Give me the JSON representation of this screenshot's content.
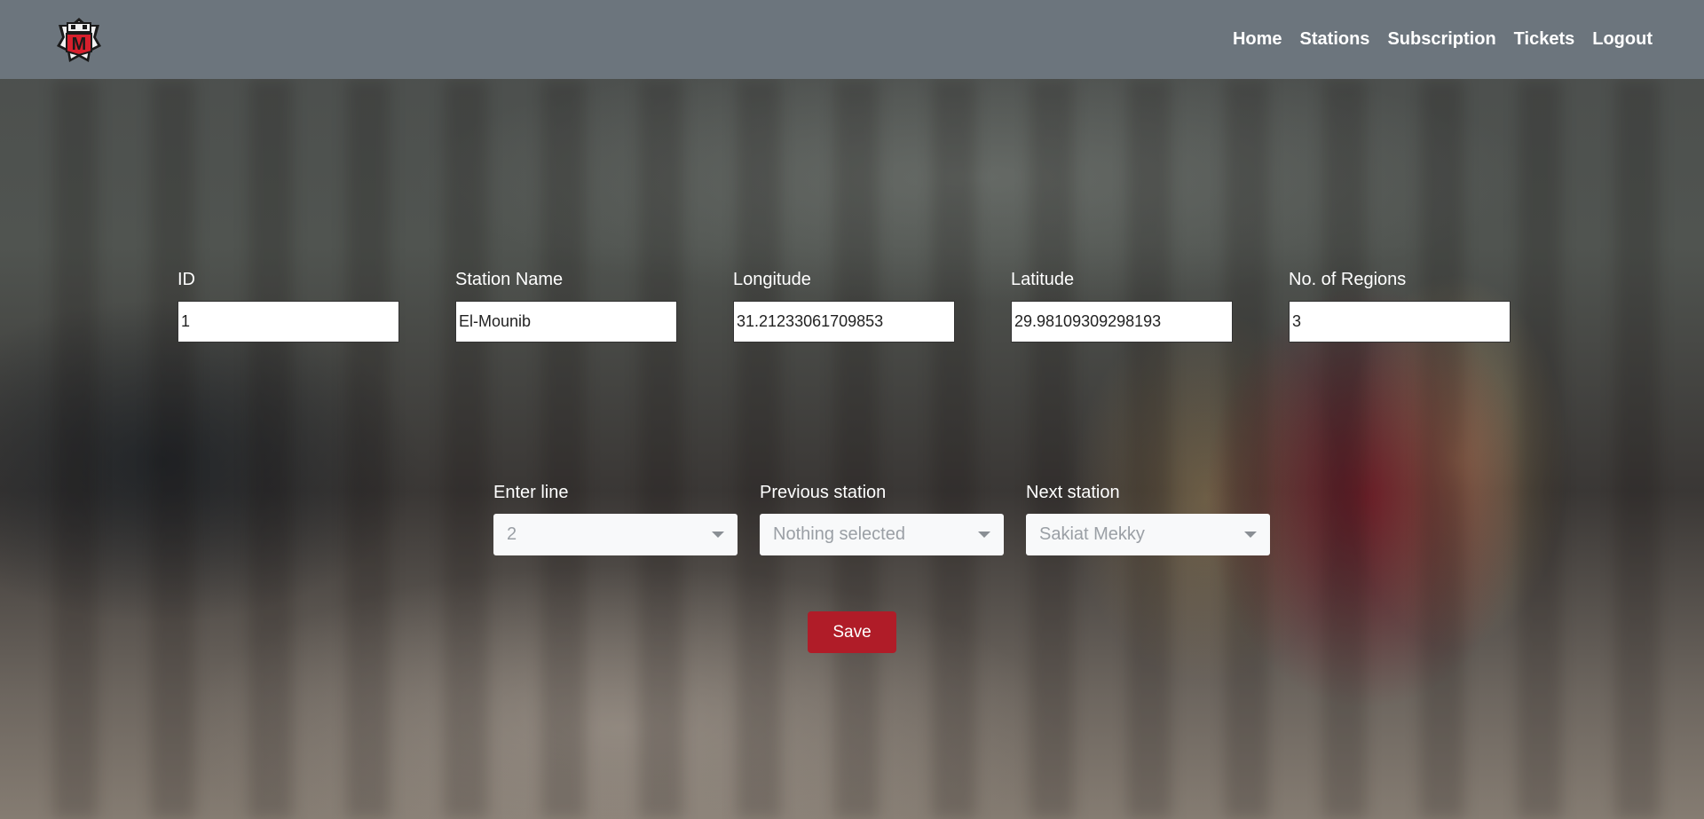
{
  "brand": {
    "logo_icon": "metro-logo-icon",
    "logo_letter": "M",
    "colors": {
      "navbar_bg": "#6c757d",
      "logo_red": "#d8202d",
      "save_button": "#b01c28"
    }
  },
  "nav": {
    "items": [
      {
        "label": "Home"
      },
      {
        "label": "Stations"
      },
      {
        "label": "Subscription"
      },
      {
        "label": "Tickets"
      },
      {
        "label": "Logout"
      }
    ]
  },
  "form": {
    "fields": [
      {
        "label": "ID",
        "value": "1"
      },
      {
        "label": "Station Name",
        "value": "El-Mounib"
      },
      {
        "label": "Longitude",
        "value": "31.21233061709853"
      },
      {
        "label": "Latitude",
        "value": "29.98109309298193"
      },
      {
        "label": "No. of Regions",
        "value": "3"
      }
    ],
    "selects": [
      {
        "label": "Enter line",
        "value": "2"
      },
      {
        "label": "Previous station",
        "value": "Nothing selected"
      },
      {
        "label": "Next station",
        "value": "Sakiat Mekky"
      }
    ],
    "save_label": "Save"
  }
}
